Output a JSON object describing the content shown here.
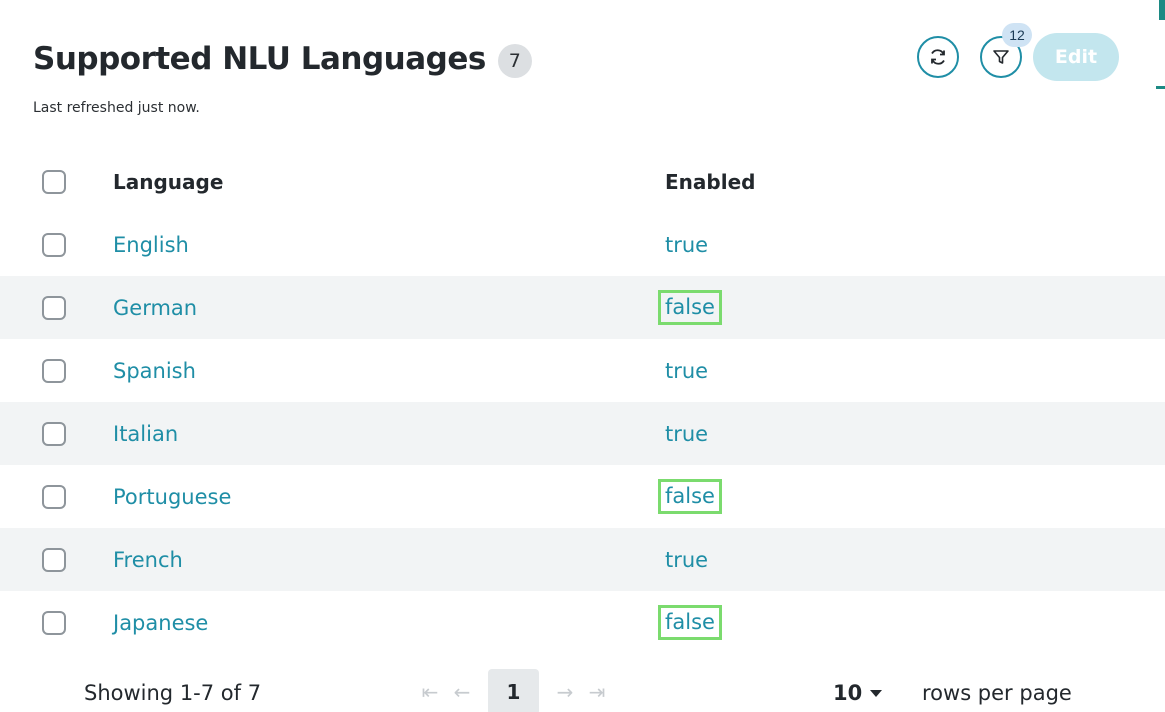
{
  "header": {
    "title": "Supported NLU Languages",
    "count": "7",
    "subtitle": "Last refreshed just now."
  },
  "actions": {
    "refresh_icon": "refresh-icon",
    "filter_icon": "filter-icon",
    "filter_badge": "12",
    "edit_label": "Edit"
  },
  "table": {
    "columns": [
      "Language",
      "Enabled"
    ],
    "rows": [
      {
        "language": "English",
        "enabled": "true",
        "highlighted": false
      },
      {
        "language": "German",
        "enabled": "false",
        "highlighted": true
      },
      {
        "language": "Spanish",
        "enabled": "true",
        "highlighted": false
      },
      {
        "language": "Italian",
        "enabled": "true",
        "highlighted": false
      },
      {
        "language": "Portuguese",
        "enabled": "false",
        "highlighted": true
      },
      {
        "language": "French",
        "enabled": "true",
        "highlighted": false
      },
      {
        "language": "Japanese",
        "enabled": "false",
        "highlighted": true
      }
    ]
  },
  "footer": {
    "showing": "Showing 1-7 of 7",
    "current_page": "1",
    "rows_per_page_value": "10",
    "rows_per_page_label": "rows per page"
  },
  "colors": {
    "accent": "#1f8ea6",
    "highlight": "#7bdb6e",
    "edit_disabled": "#c3e6ee"
  }
}
